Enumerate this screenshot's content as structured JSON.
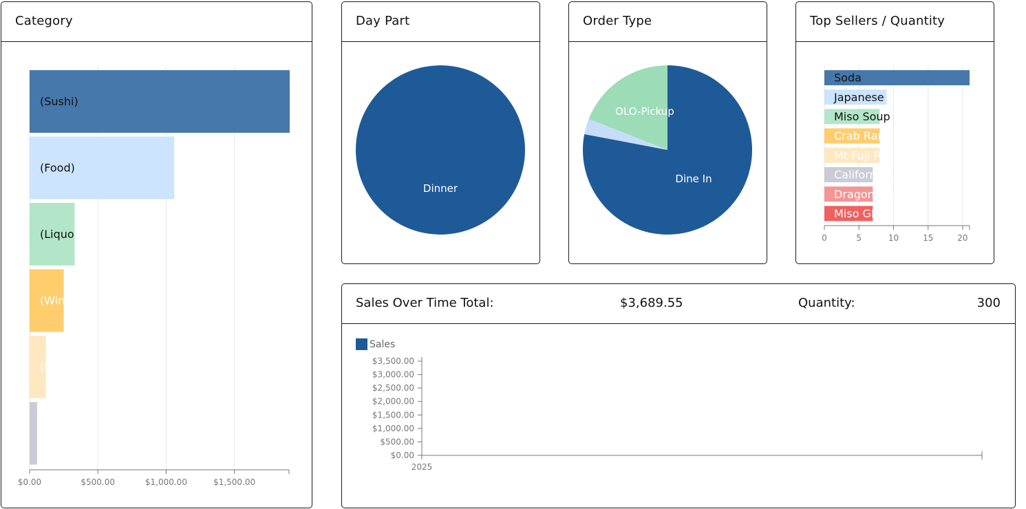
{
  "cards": {
    "category": {
      "title": "Category"
    },
    "day_part": {
      "title": "Day Part"
    },
    "order_type": {
      "title": "Order Type"
    },
    "top_sellers": {
      "title": "Top Sellers / Quantity"
    },
    "sales": {
      "title": "Sales Over Time Total:",
      "total": "$3,689.55",
      "quantity_label": "Quantity:",
      "quantity": "300"
    }
  },
  "colors": {
    "palette": [
      "#4678ab",
      "#cce4fd",
      "#b3e6c9",
      "#ffcd6c",
      "#ffe7c2",
      "#c9ccd6",
      "#f59494",
      "#ef6060"
    ],
    "primary": "#1f5a98",
    "order_type": [
      "#1f5a98",
      "#c6ddf9",
      "#9cdcb6"
    ]
  },
  "chart_data": [
    {
      "id": "category",
      "type": "bar",
      "orientation": "horizontal",
      "categories": [
        "(Sushi)",
        "(Food)",
        "(Liquor)",
        "(Wine)",
        "(Beer)",
        ""
      ],
      "values": [
        1905,
        1060,
        330,
        250,
        120,
        55
      ],
      "xlim": [
        0,
        1900
      ],
      "xticks": [
        0,
        500,
        1000,
        1500
      ],
      "xtick_labels": [
        "$0.00",
        "$500.00",
        "$1,000.00",
        "$1,500.00"
      ],
      "grid": true
    },
    {
      "id": "day_part",
      "type": "pie",
      "labels": [
        "Dinner"
      ],
      "values": [
        100
      ]
    },
    {
      "id": "order_type",
      "type": "pie",
      "labels": [
        "Dine In",
        "",
        "OLO-Pickup"
      ],
      "values": [
        78,
        3,
        19
      ]
    },
    {
      "id": "top_sellers",
      "type": "bar",
      "orientation": "horizontal",
      "categories": [
        "Soda",
        "Japanese",
        "Miso Soup",
        "Crab Rangoon",
        "Mt Fuji Roll",
        "California Roll",
        "Dragon Roll",
        "Miso Glazed"
      ],
      "values": [
        21,
        9,
        8,
        8,
        8,
        7,
        7,
        7
      ],
      "xlim": [
        0,
        21
      ],
      "xticks": [
        0,
        5,
        10,
        15,
        20
      ],
      "grid": true
    },
    {
      "id": "sales_over_time",
      "type": "line",
      "series": [
        {
          "name": "Sales",
          "values": []
        }
      ],
      "x": [
        "2025"
      ],
      "ylim": [
        0,
        3500
      ],
      "yticks": [
        0,
        500,
        1000,
        1500,
        2000,
        2500,
        3000,
        3500
      ],
      "ytick_labels": [
        "$0.00",
        "$500.00",
        "$1,000.00",
        "$1,500.00",
        "$2,000.00",
        "$2,500.00",
        "$3,000.00",
        "$3,500.00"
      ],
      "legend": "top-left"
    }
  ]
}
